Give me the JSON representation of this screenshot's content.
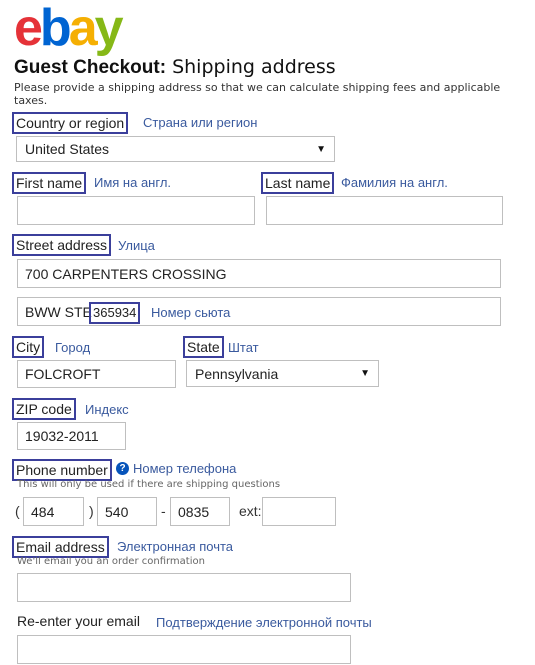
{
  "logo": {
    "letters": [
      "e",
      "b",
      "a",
      "y"
    ],
    "colors": [
      "#e53238",
      "#0064d2",
      "#f5af02",
      "#86b817"
    ]
  },
  "header": {
    "title_bold": "Guest Checkout:",
    "title_rest": "Shipping address",
    "subtitle": "Please provide a shipping address so that we can calculate shipping fees and applicable taxes."
  },
  "country": {
    "label": "Country or region",
    "ru": "Страна или регион",
    "value": "United States"
  },
  "first_name": {
    "label": "First name",
    "ru": "Имя на англ.",
    "value": ""
  },
  "last_name": {
    "label": "Last name",
    "ru": "Фамилия на англ.",
    "value": ""
  },
  "street": {
    "label": "Street address",
    "ru": "Улица",
    "line1": "700 CARPENTERS CROSSING",
    "line2_prefix": "BWW STE ",
    "line2_suite": "365934",
    "suite_ru": "Номер сьюта"
  },
  "city": {
    "label": "City",
    "ru": "Город",
    "value": "FOLCROFT"
  },
  "state": {
    "label": "State",
    "ru": "Штат",
    "value": "Pennsylvania"
  },
  "zip": {
    "label": "ZIP code",
    "ru": "Индекс",
    "value": "19032-2011"
  },
  "phone": {
    "label": "Phone number",
    "help": "?",
    "ru": "Номер телефона",
    "hint": "This will only be used if there are shipping questions",
    "open_paren": "(",
    "close_paren": ")",
    "dash": "-",
    "area": "484",
    "prefix": "540",
    "line": "0835",
    "ext_label": "ext:",
    "ext": ""
  },
  "email": {
    "label": "Email address",
    "ru": "Электронная почта",
    "hint": "We'll email you an order confirmation",
    "value": ""
  },
  "email_confirm": {
    "label": "Re-enter your email",
    "ru": "Подтверждение электронной почты",
    "value": ""
  }
}
